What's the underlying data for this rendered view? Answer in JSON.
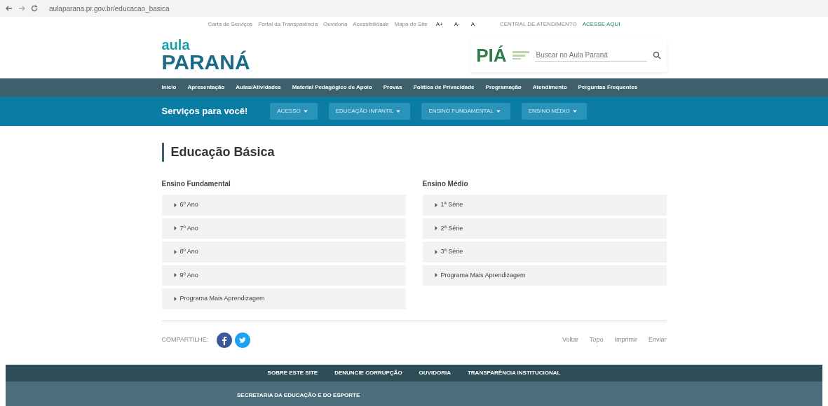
{
  "browser": {
    "url": "aulaparana.pr.gov.br/educacao_basica"
  },
  "gov_bar": {
    "links": [
      "Carta de Serviços",
      "Portal da Transparência",
      "Ouvidoria",
      "Acessibilidade",
      "Mapa do Site"
    ],
    "font_buttons": [
      "A+",
      "A-",
      "A"
    ],
    "notice": "CENTRAL DE ATENDIMENTO",
    "notice_link": "ACESSE AQUI"
  },
  "header": {
    "logo_top": "aula",
    "logo_bottom": "PARANÁ",
    "pia": "PIÁ",
    "search": {
      "placeholder": "Buscar no Aula Paraná"
    }
  },
  "nav": [
    "Início",
    "Apresentação",
    "Aulas/Atividades",
    "Material Pedagógico de Apoio",
    "Provas",
    "Política de Privacidade",
    "Programação",
    "Atendimento",
    "Perguntas Frequentes"
  ],
  "services": {
    "title": "Serviços para você!",
    "buttons": [
      "ACESSO",
      "EDUCAÇÃO INFANTIL",
      "ENSINO FUNDAMENTAL",
      "ENSINO MÉDIO"
    ]
  },
  "page_title": "Educação Básica",
  "columns": [
    {
      "heading": "Ensino Fundamental",
      "items": [
        "6º Ano",
        "7º Ano",
        "8º Ano",
        "9º Ano",
        "Programa Mais Aprendizagem"
      ]
    },
    {
      "heading": "Ensino Médio",
      "items": [
        "1ª Série",
        "2ª Série",
        "3ª Série",
        "Programa Mais Aprendizagem"
      ]
    }
  ],
  "share": {
    "label": "COMPARTILHE:"
  },
  "page_actions": [
    "Voltar",
    "Topo",
    "Imprimir",
    "Enviar"
  ],
  "footer": {
    "links": [
      "SOBRE ESTE SITE",
      "DENUNCIE CORRUPÇÃO",
      "OUVIDORIA",
      "TRANSPARÊNCIA INSTITUCIONAL"
    ],
    "secretaria": "SECRETARIA DA EDUCAÇÃO E DO ESPORTE"
  }
}
